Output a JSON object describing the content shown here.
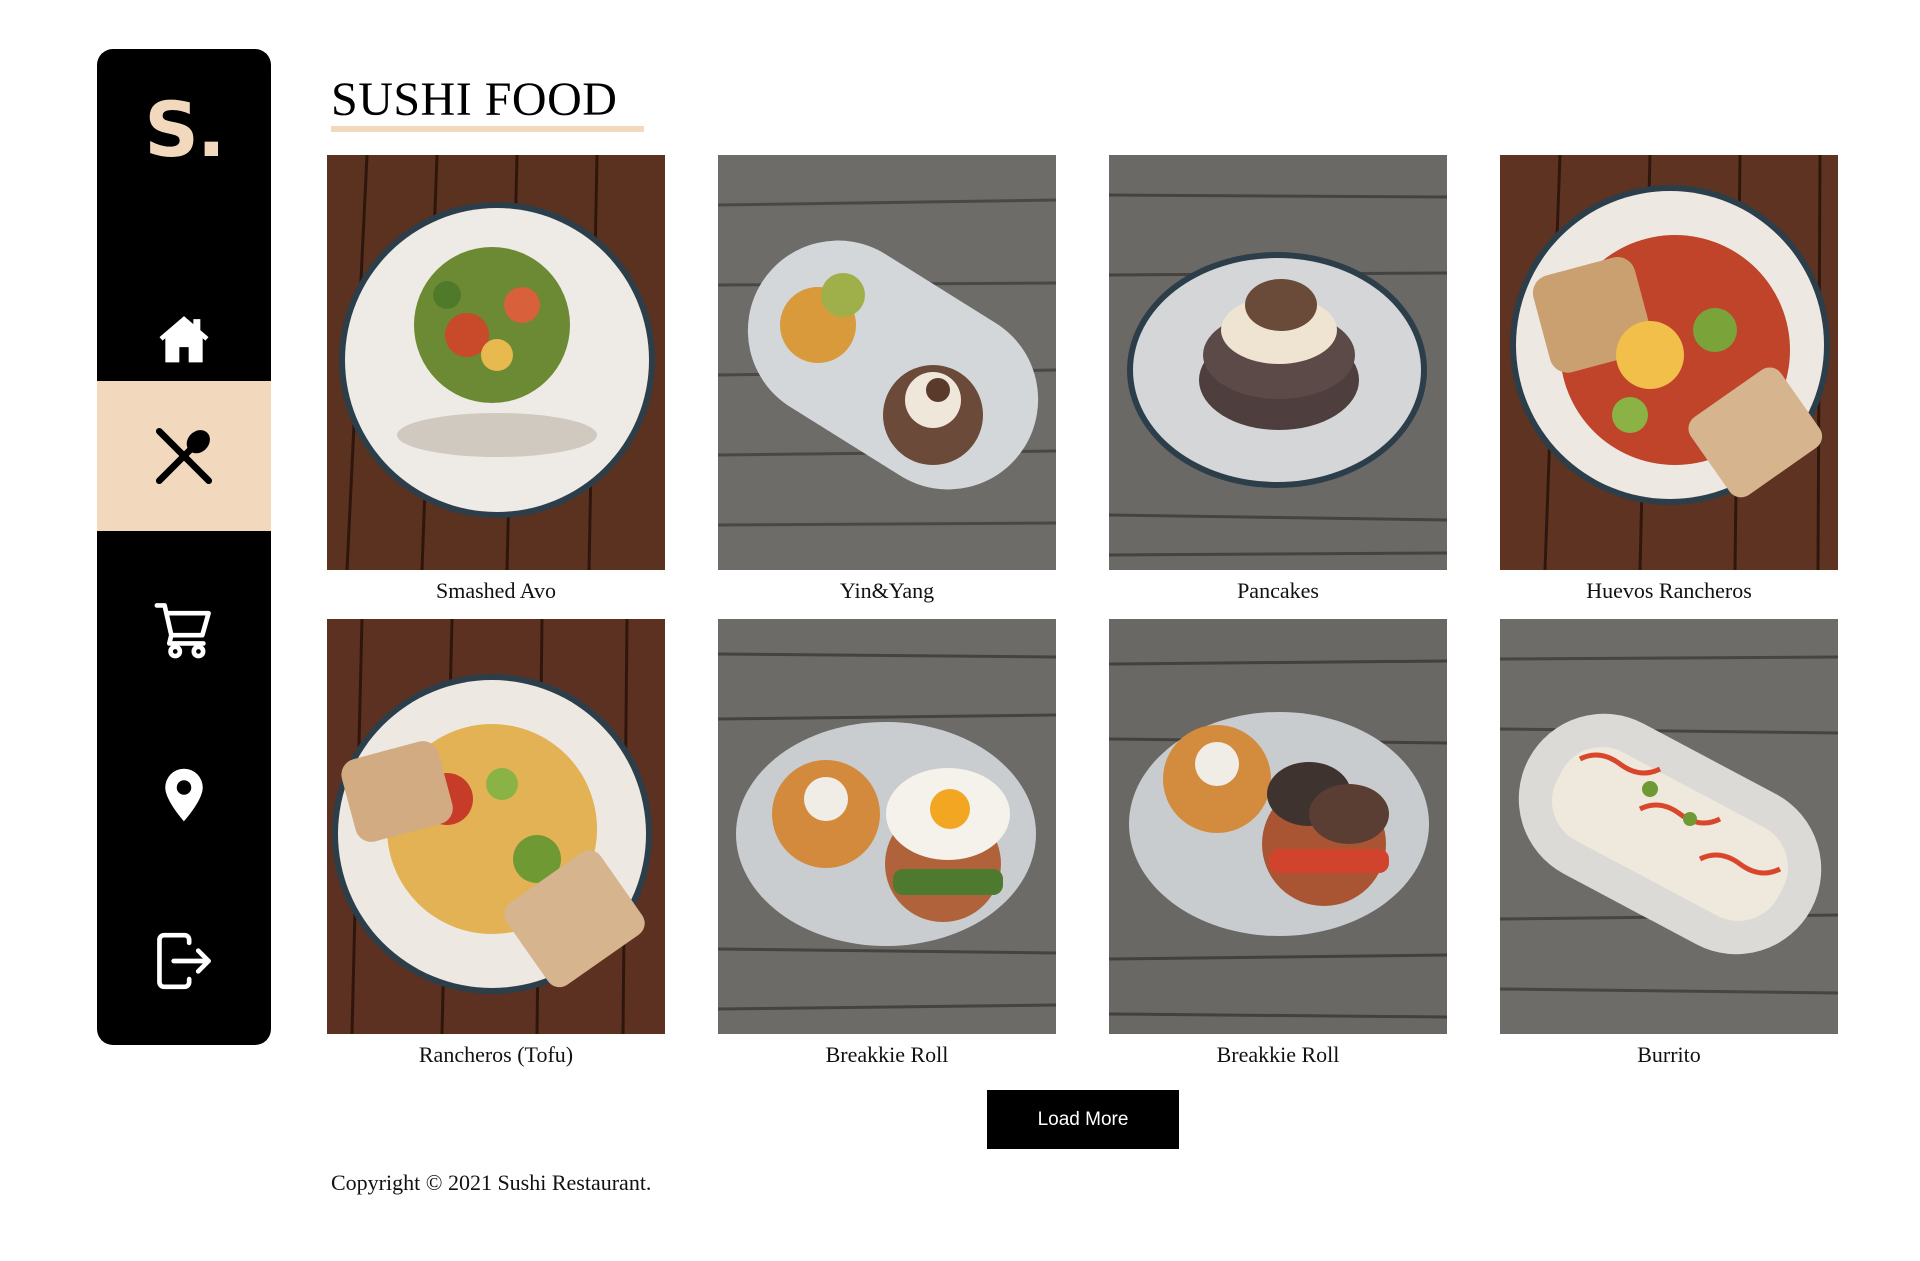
{
  "brand": {
    "logo_text": "S.",
    "accent_color": "#f2d8bd"
  },
  "sidebar": {
    "items": [
      {
        "icon": "home-icon",
        "active": false
      },
      {
        "icon": "utensils-icon",
        "active": true
      },
      {
        "icon": "cart-icon",
        "active": false
      },
      {
        "icon": "map-pin-icon",
        "active": false
      },
      {
        "icon": "logout-icon",
        "active": false
      }
    ]
  },
  "page": {
    "title": "SUSHI FOOD"
  },
  "menu": {
    "items": [
      {
        "name": "Smashed Avo",
        "image": "salad-plate-on-dark-wood"
      },
      {
        "name": "Yin&Yang",
        "image": "oval-plate-fritter-and-pancake"
      },
      {
        "name": "Pancakes",
        "image": "pancake-stack-on-plate"
      },
      {
        "name": "Huevos Rancheros",
        "image": "eggs-toast-jalapeno-plate"
      },
      {
        "name": "Rancheros (Tofu)",
        "image": "tofu-scramble-toast-plate"
      },
      {
        "name": "Breakkie Roll",
        "image": "egg-bacon-roll-on-plate"
      },
      {
        "name": "Breakkie Roll",
        "image": "mushroom-roll-on-plate"
      },
      {
        "name": "Burrito",
        "image": "burrito-on-oval-plate"
      }
    ]
  },
  "actions": {
    "load_more_label": "Load More"
  },
  "footer": {
    "copyright": "Copyright © 2021 Sushi Restaurant."
  }
}
